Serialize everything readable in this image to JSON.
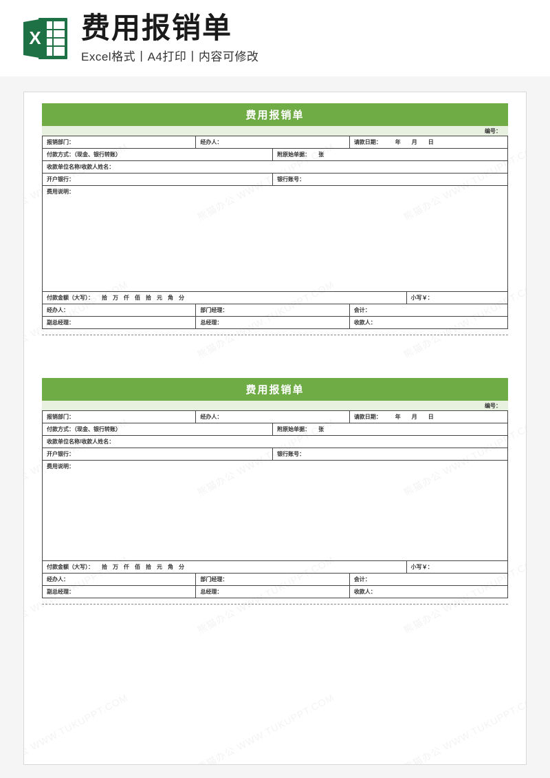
{
  "header": {
    "title": "费用报销单",
    "subtitle": "Excel格式丨A4打印丨内容可修改"
  },
  "form": {
    "title": "费用报销单",
    "serial_label": "编号：",
    "row1": {
      "dept": "报销部门：",
      "handler": "经办人：",
      "request_date": "请款日期：　　　年　　月　　日"
    },
    "row2": {
      "payment_method": "付款方式：（现金、银行转账）",
      "attachments": "附原始单据：　　张"
    },
    "row3": {
      "payee": "收款单位名称/收款人姓名："
    },
    "row4": {
      "bank": "开户银行：",
      "account": "银行账号："
    },
    "row5": {
      "desc_label": "费用说明："
    },
    "row6": {
      "amount_words": "付款金额（大写）：　　拾　万　仟　佰　拾　元　角　分",
      "amount_num": "小写￥："
    },
    "row7": {
      "handler": "经办人：",
      "dept_mgr": "部门经理：",
      "accountant": "会计："
    },
    "row8": {
      "vp": "副总经理：",
      "gm": "总经理：",
      "payee2": "收款人："
    }
  },
  "watermark": "熊猫办公 WWW.TUKUPPT.COM"
}
